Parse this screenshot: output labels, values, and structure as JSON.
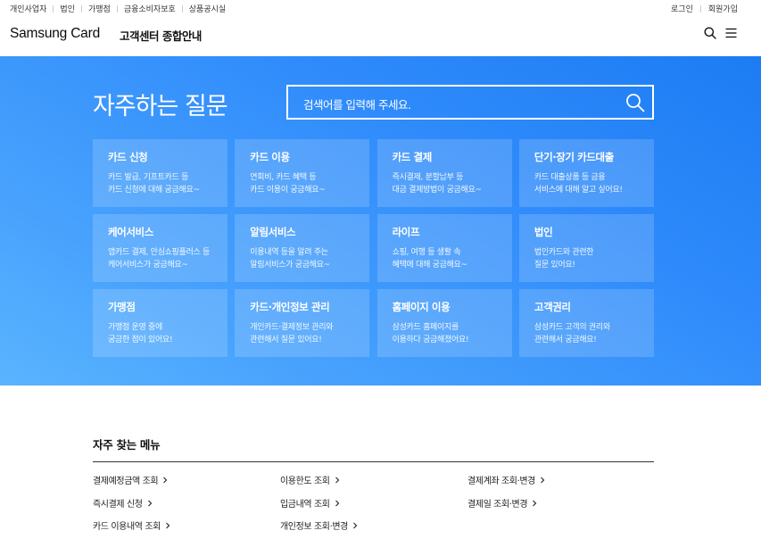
{
  "util_bar": {
    "left_links": [
      "개인사업자",
      "법인",
      "가맹점",
      "금융소비자보호",
      "상품공시실"
    ],
    "right_links": [
      "로그인",
      "회원가입"
    ]
  },
  "header": {
    "logo": "Samsung Card",
    "title": "고객센터 종합안내",
    "icons": [
      "search-icon",
      "hamburger-menu-icon"
    ]
  },
  "hero": {
    "title": "자주하는 질문",
    "search_placeholder": "검색어를 입력해 주세요.",
    "background_color": "#2b87f8",
    "cards": [
      {
        "title": "카드 신청",
        "desc1": "카드 발급, 기프트카드 등",
        "desc2": "카드 신청에 대해 궁금해요~"
      },
      {
        "title": "카드 이용",
        "desc1": "연회비, 카드 혜택 등",
        "desc2": "카드 이용이 궁금해요~"
      },
      {
        "title": "카드 결제",
        "desc1": "즉시결제, 분할납부 등",
        "desc2": "대금 결제방법이 궁금해요~"
      },
      {
        "title": "단기·장기 카드대출",
        "desc1": "카드 대출상품 등 금융",
        "desc2": "서비스에 대해 알고 싶어요!"
      },
      {
        "title": "케어서비스",
        "desc1": "앱카드 결제, 안심쇼핑플러스 등",
        "desc2": "케어서비스가 궁금해요~"
      },
      {
        "title": "알림서비스",
        "desc1": "이용내역 등을 알려 주는",
        "desc2": "알림서비스가 궁금해요~"
      },
      {
        "title": "라이프",
        "desc1": "쇼핑, 여행 등 생활 속",
        "desc2": "혜택에 대해 궁금해요~"
      },
      {
        "title": "법인",
        "desc1": "법인카드와 관련한",
        "desc2": "질문 있어요!"
      },
      {
        "title": "가맹점",
        "desc1": "가맹점 운영 중에",
        "desc2": "궁금한 점이 있어요!"
      },
      {
        "title": "카드·개인정보 관리",
        "desc1": "개인카드·결제정보 관리와",
        "desc2": "관련해서 질문 있어요!"
      },
      {
        "title": "홈페이지 이용",
        "desc1": "삼성카드 홈페이지를",
        "desc2": "이용하다 궁금해졌어요!"
      },
      {
        "title": "고객권리",
        "desc1": "삼성카드 고객의 권리와",
        "desc2": "관련해서 궁금해요!"
      }
    ]
  },
  "frequent_menu": {
    "title": "자주 찾는 메뉴",
    "items": [
      "결제예정금액 조회",
      "이용한도 조회",
      "결제계좌 조회·변경",
      "즉시결제 신청",
      "입금내역 조회",
      "결제일 조회·변경",
      "카드 이용내역 조회",
      "개인정보 조회·변경"
    ]
  }
}
